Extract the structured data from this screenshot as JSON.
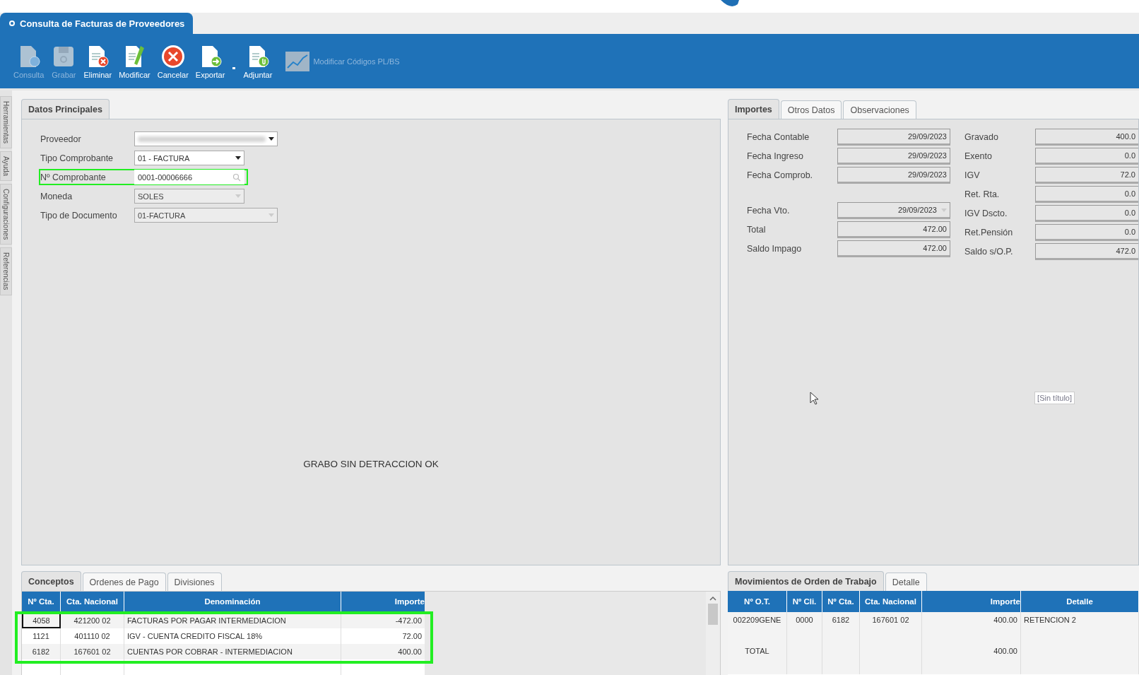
{
  "window": {
    "title": "Consulta de Facturas de Proveedores"
  },
  "toolbar": [
    {
      "label": "Consulta",
      "kind": "query",
      "disabled": true
    },
    {
      "label": "Grabar",
      "kind": "save",
      "disabled": true
    },
    {
      "label": "Eliminar",
      "kind": "delete",
      "disabled": false
    },
    {
      "label": "Modificar",
      "kind": "edit",
      "disabled": false
    },
    {
      "label": "Cancelar",
      "kind": "cancel",
      "disabled": false
    },
    {
      "label": "Exportar",
      "kind": "export",
      "disabled": false
    },
    {
      "label": "Adjuntar",
      "kind": "attach",
      "disabled": false
    },
    {
      "label": "Modificar Códigos PL/BS",
      "kind": "chart",
      "disabled": true
    }
  ],
  "side_tabs": [
    "Herramientas",
    "Ayuda",
    "Configuraciones",
    "Referencias"
  ],
  "main_tabs": [
    {
      "label": "Datos Principales",
      "selected": true
    }
  ],
  "form": [
    {
      "label": "Proveedor",
      "kind": "redacted",
      "wide": true,
      "disabled": false
    },
    {
      "label": "Tipo Comprobante",
      "kind": "dropdown",
      "value": "01 - FACTURA",
      "wide": false,
      "disabled": false
    },
    {
      "label": "Nº Comprobante",
      "kind": "search",
      "value": "0001-00006666",
      "wide": false,
      "disabled": false,
      "highlighted": true
    },
    {
      "label": "Moneda",
      "kind": "dropdown",
      "value": "SOLES",
      "wide": false,
      "disabled": true
    },
    {
      "label": "Tipo de Documento",
      "kind": "dropdown",
      "value": "01-FACTURA",
      "wide": true,
      "disabled": true
    }
  ],
  "message": "GRABO SIN DETRACCION OK",
  "amount_tabs": [
    {
      "label": "Importes",
      "selected": true
    },
    {
      "label": "Otros Datos",
      "selected": false
    },
    {
      "label": "Observaciones",
      "selected": false
    }
  ],
  "left_groups": [
    [
      {
        "label": "Fecha Contable",
        "value": "29/09/2023",
        "kind": "text"
      },
      {
        "label": "Fecha Ingreso",
        "value": "29/09/2023",
        "kind": "text"
      },
      {
        "label": "Fecha Comprob.",
        "value": "29/09/2023",
        "kind": "text"
      }
    ],
    [
      {
        "label": "Fecha Vto.",
        "value": "29/09/2023",
        "kind": "date"
      },
      {
        "label": "Total",
        "value": "472.00",
        "kind": "text"
      },
      {
        "label": "Saldo Impago",
        "value": "472.00",
        "kind": "text"
      }
    ]
  ],
  "right_fields": [
    {
      "label": "Gravado",
      "value": "400.0"
    },
    {
      "label": "Exento",
      "value": "0.0"
    },
    {
      "label": "IGV",
      "value": "72.0"
    },
    {
      "label": "Ret. Rta.",
      "value": "0.0"
    },
    {
      "label": "IGV Dscto.",
      "value": "0.0"
    },
    {
      "label": "Ret.Pensión",
      "value": "0.0"
    },
    {
      "label": "Saldo s/O.P.",
      "value": "472.0"
    }
  ],
  "untitled_label": "[Sin título]",
  "concept_tabs": [
    {
      "label": "Conceptos",
      "selected": true
    },
    {
      "label": "Ordenes de Pago",
      "selected": false
    },
    {
      "label": "Divisiones",
      "selected": false
    }
  ],
  "concepts": {
    "columns": [
      "Nº Cta.",
      "Cta. Nacional",
      "Denominación",
      "Importe"
    ],
    "rows": [
      {
        "cells": [
          "4058",
          "421200 02",
          "FACTURAS POR PAGAR INTERMEDIACION",
          "-472.00"
        ],
        "selected": true
      },
      {
        "cells": [
          "1121",
          "401110 02",
          "IGV - CUENTA CREDITO FISCAL 18%",
          "72.00"
        ],
        "selected": false
      },
      {
        "cells": [
          "6182",
          "167601 02",
          "CUENTAS POR COBRAR - INTERMEDIACION",
          "400.00"
        ],
        "selected": false
      }
    ],
    "highlighted": true
  },
  "work_tabs": [
    {
      "label": "Movimientos de Orden de Trabajo",
      "selected": true
    },
    {
      "label": "Detalle",
      "selected": false
    }
  ],
  "work_table": {
    "columns": [
      "Nº O.T.",
      "Nº Cli.",
      "Nº Cta.",
      "Cta. Nacional",
      "Importe",
      "Detalle"
    ],
    "rows": [
      [
        "002209GENE",
        "0000",
        "6182",
        "167601 02",
        "400.00",
        "RETENCION 2"
      ],
      [
        null,
        null,
        null,
        null,
        null,
        null
      ],
      [
        "TOTAL",
        null,
        null,
        null,
        "400.00",
        null
      ]
    ]
  }
}
